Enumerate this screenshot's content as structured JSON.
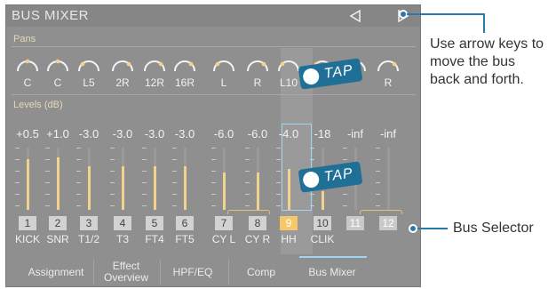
{
  "window": {
    "title": "BUS MIXER"
  },
  "sections": {
    "pans": "Pans",
    "levels": "Levels (dB)"
  },
  "channels": [
    {
      "num": "1",
      "name": "KICK",
      "pan": "C",
      "level": "+0.5",
      "fill": 0.82,
      "state": "normal"
    },
    {
      "num": "2",
      "name": "SNR",
      "pan": "C",
      "level": "+1.0",
      "fill": 0.84,
      "state": "normal"
    },
    {
      "num": "3",
      "name": "T1/2",
      "pan": "L5",
      "level": "-3.0",
      "fill": 0.7,
      "state": "normal"
    },
    {
      "num": "4",
      "name": "T3",
      "pan": "2R",
      "level": "-3.0",
      "fill": 0.7,
      "state": "normal"
    },
    {
      "num": "5",
      "name": "FT4",
      "pan": "12R",
      "level": "-3.0",
      "fill": 0.7,
      "state": "normal"
    },
    {
      "num": "6",
      "name": "FT5",
      "pan": "16R",
      "level": "-3.0",
      "fill": 0.7,
      "state": "normal"
    },
    {
      "num": "7",
      "name": "CY L",
      "pan": "L",
      "level": "-6.0",
      "fill": 0.6,
      "state": "normal"
    },
    {
      "num": "8",
      "name": "CY R",
      "pan": "R",
      "level": "-6.0",
      "fill": 0.6,
      "state": "normal"
    },
    {
      "num": "9",
      "name": "HH",
      "pan": "L10",
      "level": "-4.0",
      "fill": 0.66,
      "state": "selected"
    },
    {
      "num": "10",
      "name": "CLIK",
      "pan": "L",
      "level": "-18",
      "fill": 0.3,
      "state": "normal"
    },
    {
      "num": "11",
      "name": "",
      "pan": "",
      "level": "-inf",
      "fill": 0.0,
      "state": "dim"
    },
    {
      "num": "12",
      "name": "",
      "pan": "R",
      "level": "-inf",
      "fill": 0.0,
      "state": "dim"
    }
  ],
  "tabs": [
    {
      "label": "Assignment"
    },
    {
      "label": "Effect Overview"
    },
    {
      "label": "HPF/EQ"
    },
    {
      "label": "Comp"
    },
    {
      "label": "Bus Mixer"
    }
  ],
  "tap_badges": [
    {
      "label": "TAP"
    },
    {
      "label": "TAP"
    }
  ],
  "callouts": {
    "arrows": "Use arrow keys to move the bus back and forth.",
    "selector": "Bus Selector"
  },
  "colors": {
    "panel": "#8f8f8f",
    "fader": "#f2d38e",
    "selected": "#f5c96a",
    "accent": "#9ed6f2",
    "tap": "#1f6f96",
    "callout": "#2b79a8"
  },
  "icons": {
    "prev": "triangle-left-icon",
    "next": "triangle-right-icon"
  }
}
